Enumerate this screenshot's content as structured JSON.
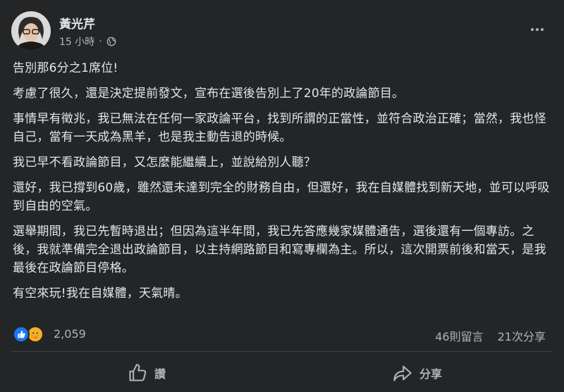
{
  "post": {
    "author": "黃光芹",
    "time": "15 小時",
    "separator": "·",
    "privacy_icon": "globe-icon",
    "more_icon": "more-icon",
    "paragraphs": [
      "告別那6分之1席位!",
      "考慮了很久，還是決定提前發文，宣布在選後告別上了20年的政論節目。",
      "事情早有徵兆，我已無法在任何一家政論平台，找到所謂的正當性，並符合政治正確；當然，我也怪自己，當有一天成為黑羊，也是我主動告退的時候。",
      "我已早不看政論節目，又怎麼能繼續上，並說給別人聽？",
      "還好，我已撐到60歲，雖然還未達到完全的財務自由，但還好，我在自媒體找到新天地，並可以呼吸到自由的空氣。",
      "選舉期間，我已先暫時退出；但因為這半年間，我已先答應幾家媒體通告，選後還有一個專訪。之後，我就準備完全退出政論節目，以主持網路節目和寫專欄為主。所以，這次開票前後和當天，是我最後在政論節目停格。",
      "有空來玩!我在自媒體，天氣晴。"
    ]
  },
  "reactions": {
    "icons": [
      "like-reaction-icon",
      "care-reaction-icon"
    ],
    "count": "2,059",
    "comments": "46則留言",
    "shares": "21次分享"
  },
  "actions": {
    "like_label": "讚",
    "share_label": "分享"
  },
  "colors": {
    "background": "#242526",
    "text": "#e4e6eb",
    "secondary": "#b0b3b8",
    "like_blue": "#1877f2",
    "care_yellow": "#f7b125"
  }
}
